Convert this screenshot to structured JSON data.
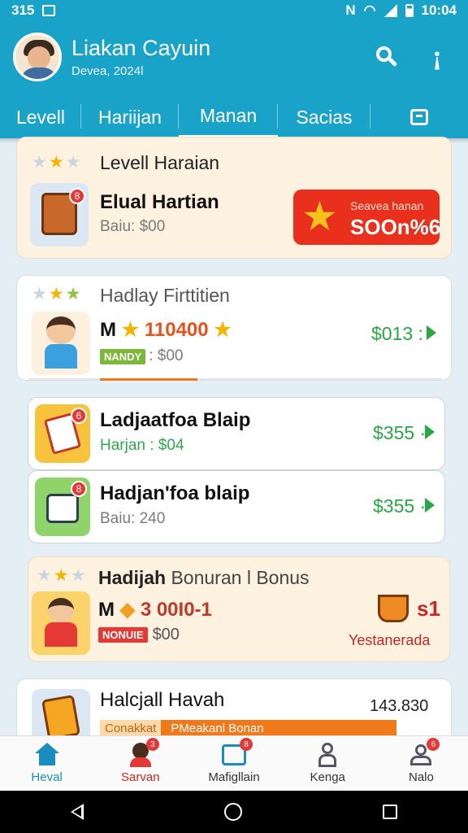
{
  "status_bar": {
    "time": "315",
    "clock": "10:04"
  },
  "header": {
    "user_name": "Liakan Cayuin",
    "subtitle": "Devea, 2024l"
  },
  "tabs": [
    {
      "label": "Levell"
    },
    {
      "label": "Hariijan"
    },
    {
      "label": "Manan"
    },
    {
      "label": "Sacias"
    }
  ],
  "cards": {
    "level_harian": {
      "title": "Levell Haraian",
      "item_title": "Elual Hartian",
      "item_sub": "Baiu: $00",
      "promo_small": "Seavea hanan",
      "promo_big": "SOOn%6"
    },
    "hadlay": {
      "title": "Hadlay Firttitien",
      "item_prefix": "M",
      "item_value": "110400",
      "tag": "NANDY",
      "tag_suffix": ": $00",
      "price": "$013 :"
    },
    "row1": {
      "title": "Ladjaatfoa Blaip",
      "sub": "Harjan : $04",
      "price": "$355 ·"
    },
    "row2": {
      "title": "Hadjan'foa blaip",
      "sub": "Baiu: 240",
      "price": "$355 ·"
    },
    "bonus": {
      "title_bold": "Hadijah",
      "title_rest": "Bonuran l Bonus",
      "item_prefix": "M",
      "item_value": "3 00I0-1",
      "tag": "NONUIE",
      "tag_suffix": "$00",
      "count": "s1",
      "footer": "Yestanerada"
    },
    "last": {
      "title": "Halcjall Havah",
      "price": "143.830",
      "tag_left": "Conakkat",
      "tag_right": "PMeakanl Bonan"
    }
  },
  "bottom_nav": [
    {
      "label": "Heval"
    },
    {
      "label": "Sarvan"
    },
    {
      "label": "Mafigllain"
    },
    {
      "label": "Kenga"
    },
    {
      "label": "Nalo"
    }
  ],
  "colors": {
    "brand": "#1aa3c8",
    "price_green": "#28a745",
    "promo_red": "#e8301c",
    "progress_orange": "#f07a1a"
  }
}
